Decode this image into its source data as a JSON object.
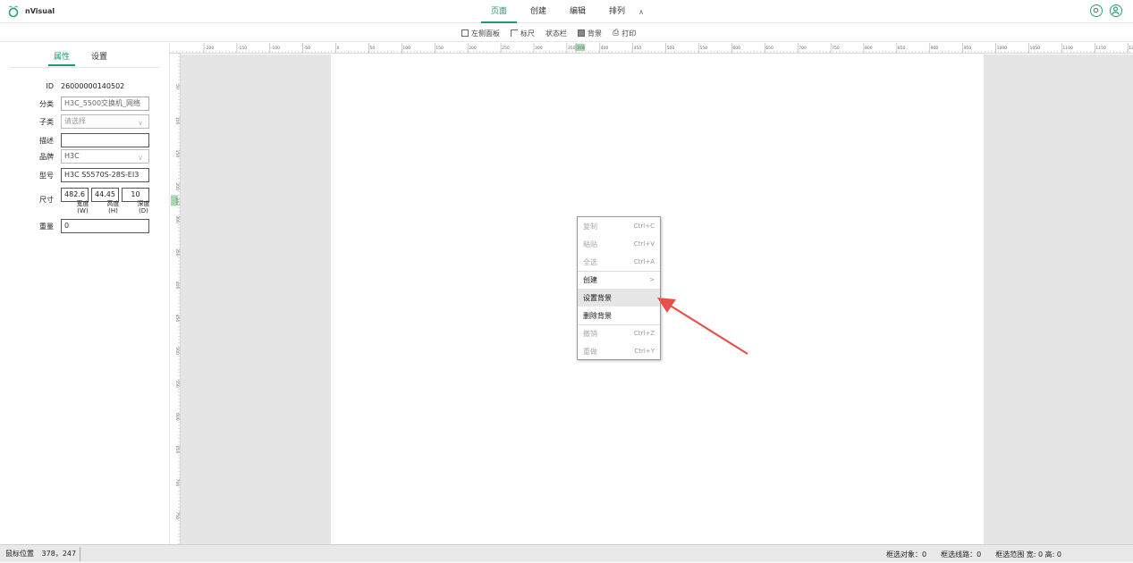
{
  "app": {
    "name": "nVisual"
  },
  "topbar": {
    "tabs": [
      "页面",
      "创建",
      "编辑",
      "排列"
    ],
    "active_tab": 0,
    "collapse_icon": "«"
  },
  "subbar": {
    "items": [
      "左侧面板",
      "标尺",
      "状态栏",
      "背景",
      "打印"
    ]
  },
  "panel": {
    "tabs": [
      "属性",
      "设置"
    ],
    "id_label": "ID",
    "id_value": "26000000140502",
    "category_label": "分类",
    "category_value": "H3C_5500交换机_网络",
    "subcategory_label": "子类",
    "subcategory_placeholder": "请选择",
    "description_label": "描述",
    "description_value": "",
    "brand_label": "品牌",
    "brand_value": "H3C",
    "model_label": "型号",
    "model_value": "H3C S5570S-28S-EI3",
    "size_label": "尺寸",
    "width_value": "482.6",
    "height_value": "44.45",
    "depth_value": "10",
    "width_label_line1": "宽度",
    "width_label_line2": "(W)",
    "height_label_line1": "高度",
    "height_label_line2": "(H)",
    "depth_label_line1": "深度",
    "depth_label_line2": "(D)",
    "weight_label": "重量",
    "weight_value": "0"
  },
  "ruler": {
    "h_labels": [
      "-200",
      "-150",
      "-100",
      "-50",
      "0",
      "50",
      "100",
      "150",
      "200",
      "250",
      "300",
      "350",
      "378",
      "400",
      "450",
      "500",
      "550",
      "600",
      "650",
      "700",
      "750",
      "800",
      "850",
      "900",
      "950",
      "1000",
      "1050",
      "1100",
      "1150",
      "1200"
    ],
    "v_labels": [
      "50",
      "100",
      "150",
      "200",
      "247",
      "300",
      "350",
      "400",
      "450",
      "500",
      "550",
      "600",
      "650",
      "700",
      "750"
    ],
    "marker_color": "#a8d8b0"
  },
  "context_menu": {
    "items": [
      {
        "label": "复制",
        "shortcut": "Ctrl+C",
        "state": "disabled"
      },
      {
        "label": "粘贴",
        "shortcut": "Ctrl+V",
        "state": "disabled"
      },
      {
        "label": "全选",
        "shortcut": "Ctrl+A",
        "state": "disabled"
      },
      {
        "label": "创建",
        "shortcut": ">",
        "state": "enabled"
      },
      {
        "label": "设置背景",
        "shortcut": "",
        "state": "hover"
      },
      {
        "label": "删除背景",
        "shortcut": "",
        "state": "enabled"
      },
      {
        "label": "撤销",
        "shortcut": "Ctrl+Z",
        "state": "disabled"
      },
      {
        "label": "重做",
        "shortcut": "Ctrl+Y",
        "state": "disabled"
      }
    ]
  },
  "statusbar": {
    "mouse_label": "鼠标位置",
    "mouse_value": "378，247",
    "selected_objects": "框选对象：0",
    "selected_lines": "框选线路：0",
    "selected_range": "框选范围 宽: 0 高: 0"
  },
  "colors": {
    "accent": "#1d9b6e",
    "arrow": "#e8504a",
    "canvas_gray": "#e5e5e5"
  }
}
